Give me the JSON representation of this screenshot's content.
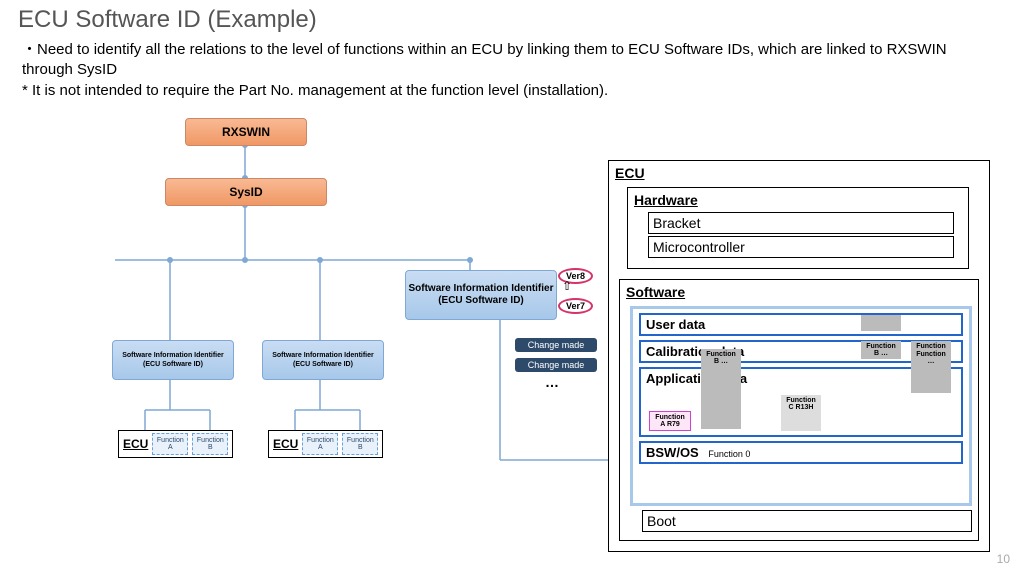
{
  "title": "ECU Software ID (Example)",
  "bullets": {
    "b1": "・Need to identify all the relations to the level of functions within an ECU by linking them to ECU Software IDs, which are linked to RXSWIN through SysID",
    "b2": "* It is not intended to require the Part No. management at the function level (installation)."
  },
  "tree": {
    "rxswin": "RXSWIN",
    "sysid": "SysID",
    "swii_main": "Software Information Identifier\n(ECU Software ID)",
    "swii_small": "Software Information Identifier\n(ECU Software ID)",
    "ecu_label": "ECU",
    "func_a": "Function A",
    "func_b": "Function B",
    "ver8": "Ver8",
    "ver7": "Ver7",
    "change": "Change made",
    "dots": "…"
  },
  "panel": {
    "ecu": "ECU",
    "hardware": "Hardware",
    "hw_bracket": "Bracket",
    "hw_micro": "Microcontroller",
    "software": "Software",
    "user_data": "User data",
    "calib_data": "Calibration data",
    "app_data": "Application data",
    "func_a": "Function A R79",
    "func_b": "Function B …",
    "func_c": "Function C R13H",
    "func_generic": "Function …",
    "bsw": "BSW/OS",
    "bsw_fn0": "Function 0",
    "boot": "Boot"
  },
  "pagenum": "10"
}
